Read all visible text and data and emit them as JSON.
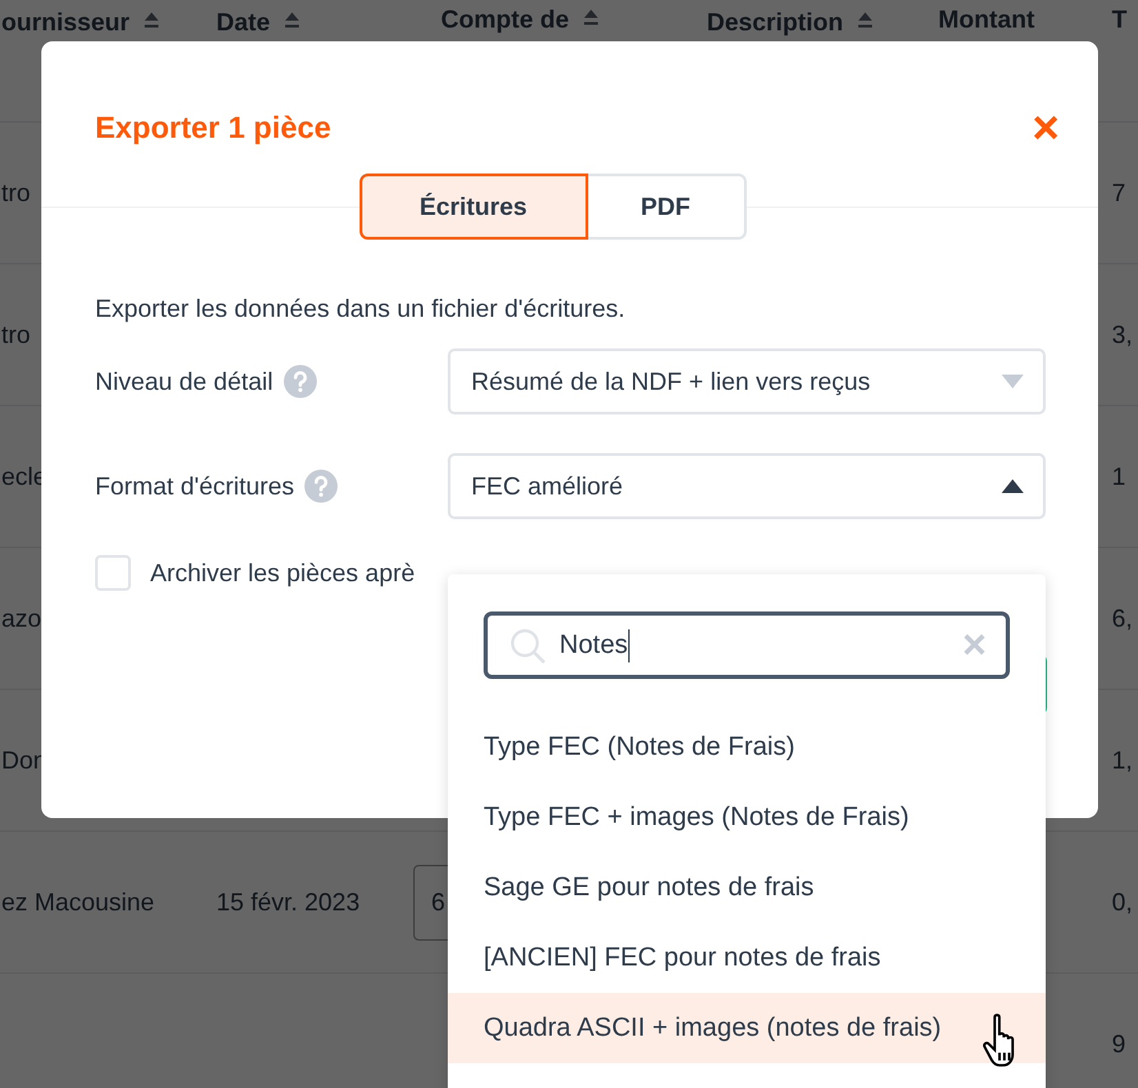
{
  "table": {
    "columns": [
      {
        "label": "ournisseur",
        "sortable": true
      },
      {
        "label": "Date",
        "sortable": true
      },
      {
        "label": "Compte de",
        "sortable": true
      },
      {
        "label": "Description",
        "sortable": true
      },
      {
        "label": "Montant",
        "sortable": false
      },
      {
        "label": "T",
        "sortable": false
      }
    ],
    "rows": [
      {
        "supplier": "tro",
        "last": "7"
      },
      {
        "supplier": "tro",
        "last": "3,"
      },
      {
        "supplier": "ecle",
        "last": "1"
      },
      {
        "supplier": "azo",
        "last": "6,"
      },
      {
        "supplier": "Don",
        "last": "1,"
      },
      {
        "supplier": "ez Macousine",
        "date": "15 févr. 2023",
        "account": "6",
        "last": "0,"
      },
      {
        "supplier": "",
        "last": "9"
      }
    ]
  },
  "modal": {
    "title": "Exporter 1 pièce",
    "close": "×",
    "tabs": [
      {
        "label": "Écritures",
        "selected": true
      },
      {
        "label": "PDF",
        "selected": false
      }
    ],
    "intro": "Exporter les données dans un fichier d'écritures.",
    "fields": [
      {
        "label": "Niveau de détail",
        "value": "Résumé de la NDF + lien vers reçus",
        "open": false
      },
      {
        "label": "Format d'écritures",
        "value": "FEC amélioré",
        "open": true
      }
    ],
    "archive": {
      "label": "Archiver les pièces aprè",
      "checked": false
    }
  },
  "dropdown": {
    "search": "Notes",
    "clear": "×",
    "options": [
      {
        "label": "Type FEC (Notes de Frais)",
        "hovered": false
      },
      {
        "label": "Type FEC + images (Notes de Frais)",
        "hovered": false
      },
      {
        "label": "Sage GE pour notes de frais",
        "hovered": false
      },
      {
        "label": "[ANCIEN] FEC pour notes de frais",
        "hovered": false
      },
      {
        "label": "Quadra ASCII + images (notes de frais)",
        "hovered": true
      }
    ]
  }
}
